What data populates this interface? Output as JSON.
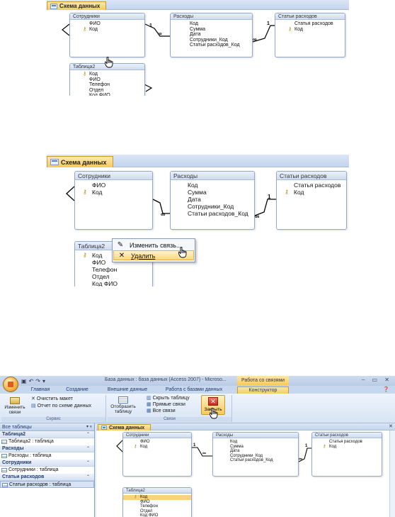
{
  "colors": {
    "tab_active": "#f8c95a",
    "tab_bar": "#c4d5ed",
    "table_header": "#cfdcef",
    "selection": "#f9d27d",
    "relation_line": "#000000"
  },
  "design_tab": {
    "title": "Схема данных",
    "icon": "relationships-icon"
  },
  "tables": {
    "employees": {
      "title": "Сотрудники",
      "fields": [
        "ФИО",
        "Код"
      ],
      "key_field_index": 1
    },
    "expenses": {
      "title": "Расходы",
      "fields": [
        "Код",
        "Сумма",
        "Дата",
        "Сотрудники_Код",
        "Статьи расходов_Код"
      ]
    },
    "expense_items": {
      "title": "Статьи расходов",
      "fields": [
        "Статья расходов",
        "Код"
      ],
      "key_field_index": 1
    },
    "table2": {
      "title": "Таблица2",
      "fields": [
        "Код",
        "ФИО",
        "Телефон",
        "Отдел",
        "Код ФИО"
      ],
      "key_field_index": 0
    }
  },
  "relation_labels": {
    "one": "1",
    "many": "∞"
  },
  "context_menu": {
    "items": [
      {
        "label": "Изменить связь...",
        "icon": "edit-relationship-icon"
      },
      {
        "label": "Удалить",
        "icon": "delete-x-icon"
      }
    ]
  },
  "window": {
    "title": "База данных : база данных (Access 2007) - Microso...",
    "context_tab_group": "Работа со связями",
    "controls": "– ▭ ✕"
  },
  "ribbon_tabs": [
    "Главная",
    "Создание",
    "Внешние данные",
    "Работа с базами данных",
    "Конструктор"
  ],
  "ribbon": {
    "change_links": "Изменить связи",
    "clear_layout": "Очистить макет",
    "schema_report": "Отчет по схеме данных",
    "group_service": "Сервис",
    "show_table": "Отобразить таблицу",
    "hide_table": "Скрыть таблицу",
    "direct_links": "Прямые связи",
    "all_links": "Все связи",
    "close": "Закрыть",
    "group_links": "Связи"
  },
  "nav_pane": {
    "header": "Все таблицы",
    "groups": [
      {
        "name": "Таблица2",
        "item": "Таблица2 : таблица"
      },
      {
        "name": "Расходы",
        "item": "Расходы : таблица"
      },
      {
        "name": "Сотрудники",
        "item": "Сотрудники : таблица"
      },
      {
        "name": "Статьи расходов",
        "item": "Статьи расходов : таблица"
      }
    ]
  }
}
